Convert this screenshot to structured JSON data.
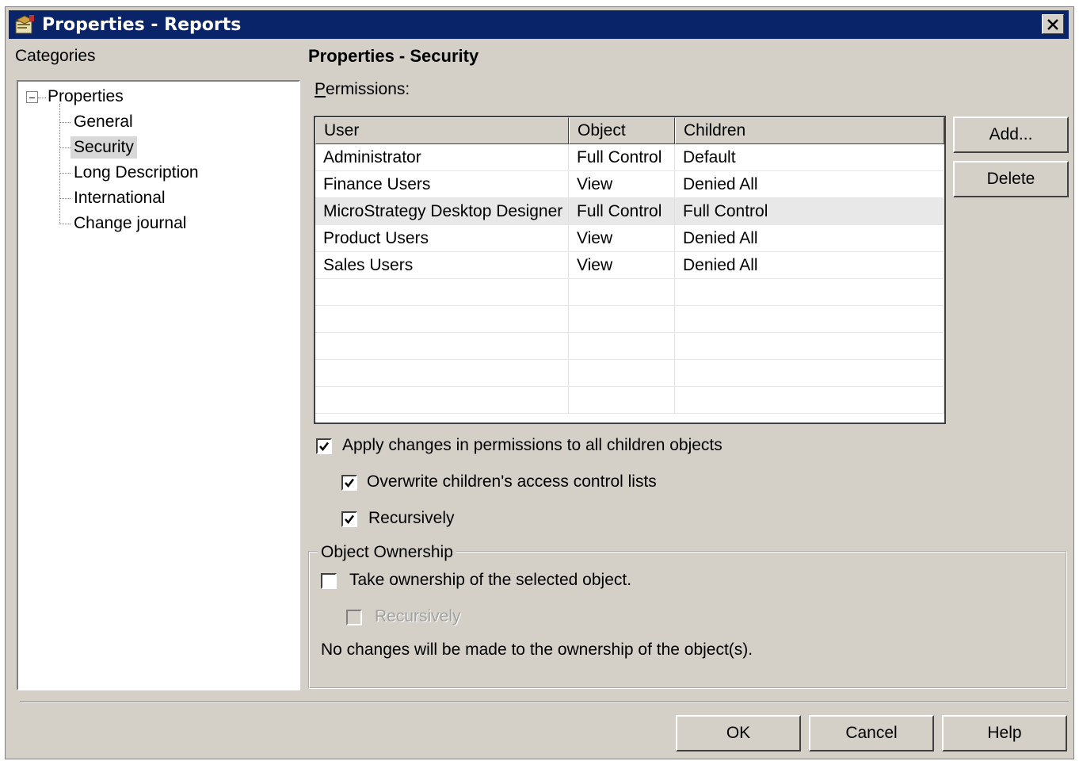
{
  "window": {
    "title": "Properties - Reports",
    "titlebar_color": "#0a246a",
    "face_color": "#d4d0c8"
  },
  "categories": {
    "label": "Categories",
    "tree": {
      "root": "Properties",
      "expander": "−",
      "children": [
        "General",
        "Security",
        "Long Description",
        "International",
        "Change journal"
      ],
      "selected": "Security"
    }
  },
  "panel": {
    "heading": "Properties - Security",
    "permissions_label_first": "P",
    "permissions_label_rest": "ermissions:"
  },
  "grid": {
    "columns": [
      "User",
      "Object",
      "Children"
    ],
    "rows": [
      {
        "user": "Administrator",
        "object": "Full Control",
        "children": "Default"
      },
      {
        "user": "Finance Users",
        "object": "View",
        "children": "Denied All"
      },
      {
        "user": "MicroStrategy Desktop Designer",
        "object": "Full Control",
        "children": "Full Control"
      },
      {
        "user": "Product Users",
        "object": "View",
        "children": "Denied All"
      },
      {
        "user": "Sales Users",
        "object": "View",
        "children": "Denied All"
      }
    ],
    "selected_row": 2
  },
  "buttons": {
    "add": "Add...",
    "delete": "Delete",
    "ok": "OK",
    "cancel": "Cancel",
    "help": "Help"
  },
  "options": {
    "apply_changes": {
      "label": "Apply changes in permissions to all children objects",
      "checked": true
    },
    "overwrite": {
      "label": "Overwrite children's access control lists",
      "checked": true
    },
    "recursively": {
      "label": "Recursively",
      "checked": true
    }
  },
  "ownership": {
    "group_title": "Object Ownership",
    "take_ownership": {
      "label": "Take ownership of the selected object.",
      "checked": false
    },
    "recursively": {
      "label": "Recursively",
      "checked": false,
      "disabled": true
    },
    "note": "No changes will be made to the ownership of the object(s)."
  }
}
